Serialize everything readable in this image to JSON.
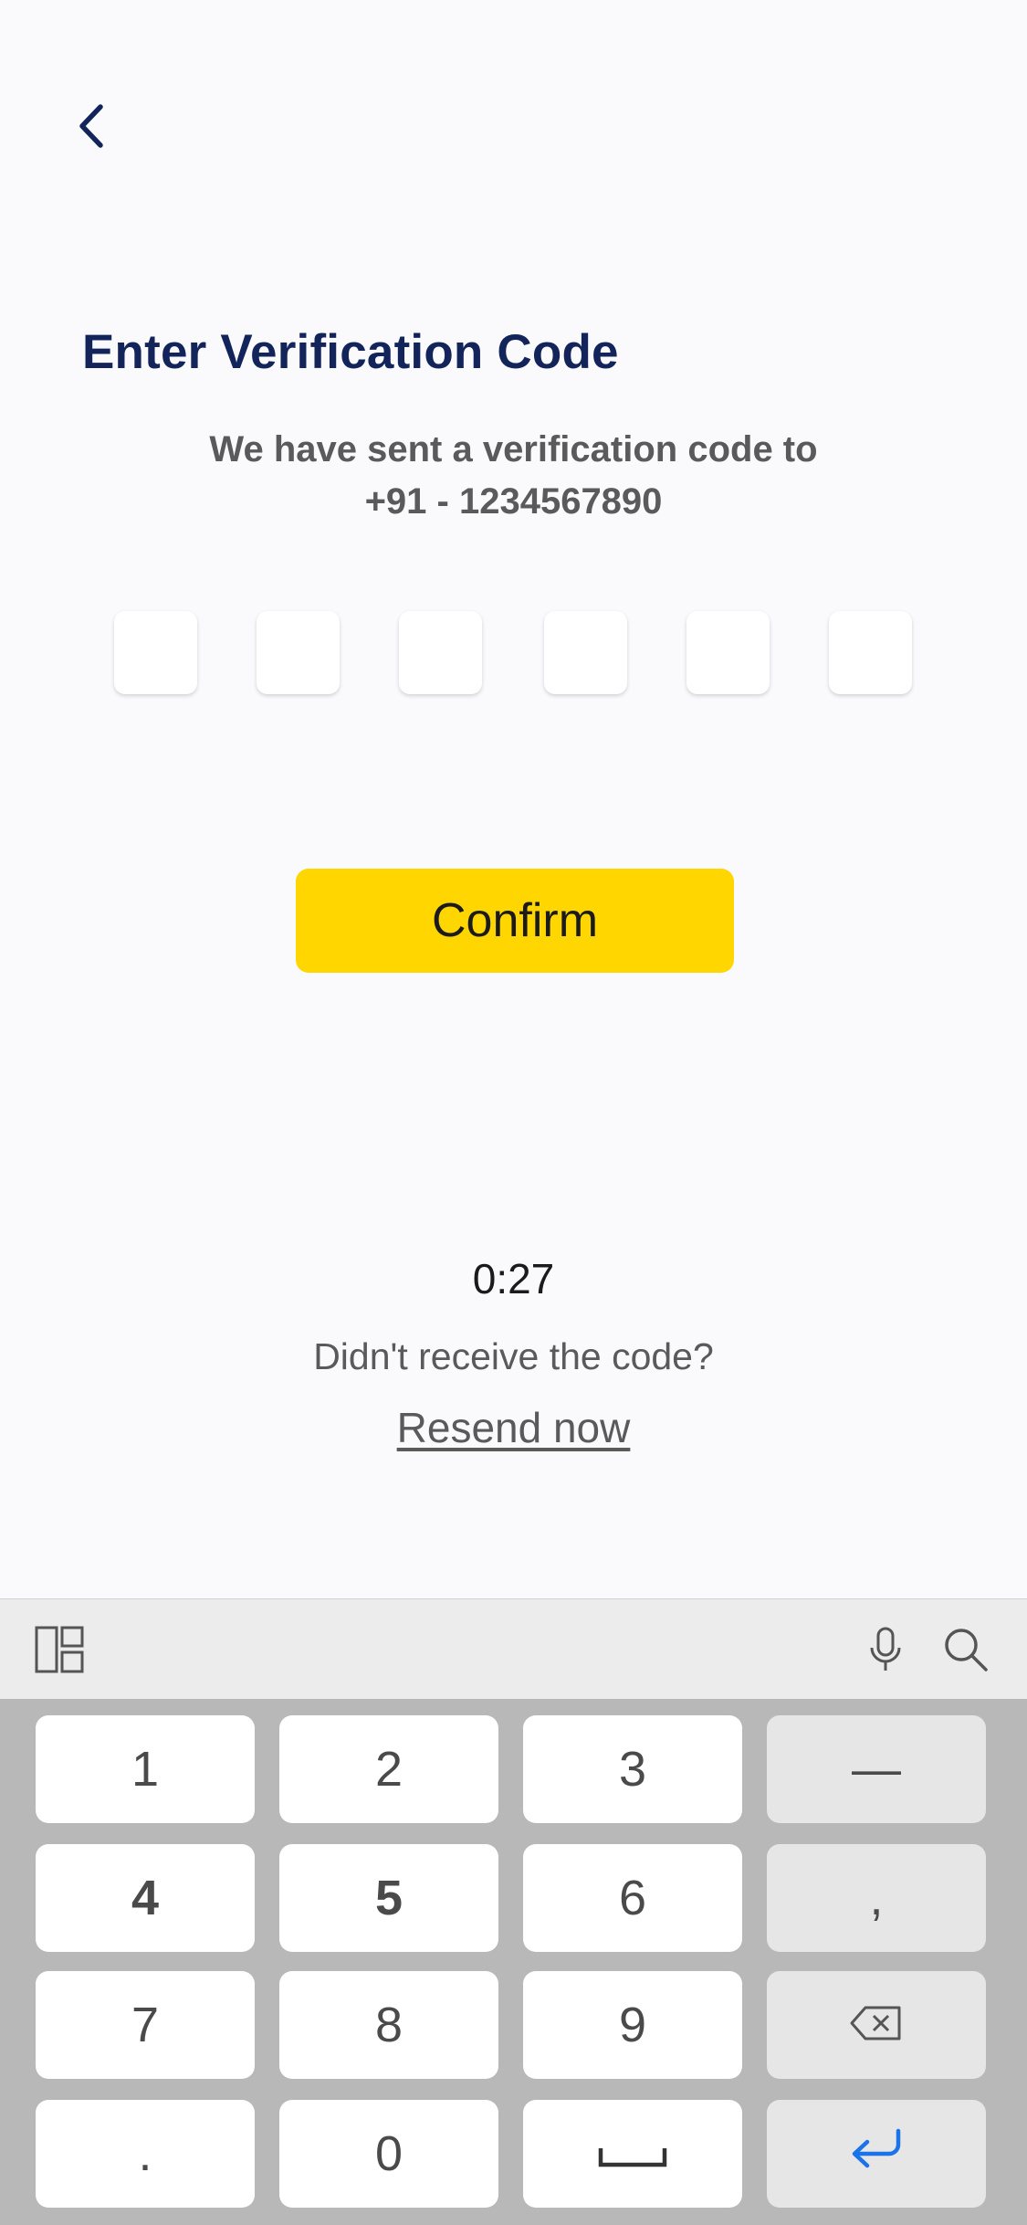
{
  "header": {
    "back_icon": "chevron-left-icon"
  },
  "verification": {
    "title": "Enter Verification Code",
    "subtitle_line1": "We have sent a verification code to",
    "subtitle_line2": "+91 - 1234567890",
    "code_length": 6
  },
  "confirm_label": "Confirm",
  "timer": "0:27",
  "resend": {
    "prompt": "Didn't receive the code?",
    "link": "Resend now"
  },
  "keyboard": {
    "toolbar": {
      "layout_icon": "keyboard-layout-icon",
      "mic_icon": "microphone-icon",
      "search_icon": "search-icon"
    },
    "keys": {
      "k1": "1",
      "k2": "2",
      "k3": "3",
      "dash": "—",
      "k4": "4",
      "k5": "5",
      "k6": "6",
      "comma": ",",
      "k7": "7",
      "k8": "8",
      "k9": "9",
      "backspace_icon": "backspace-icon",
      "period": ".",
      "k0": "0",
      "space_icon": "space-bar-icon",
      "enter_icon": "enter-icon"
    }
  },
  "colors": {
    "title": "#13245a",
    "confirm_button": "#ffd600",
    "enter_icon": "#1a73e8"
  }
}
